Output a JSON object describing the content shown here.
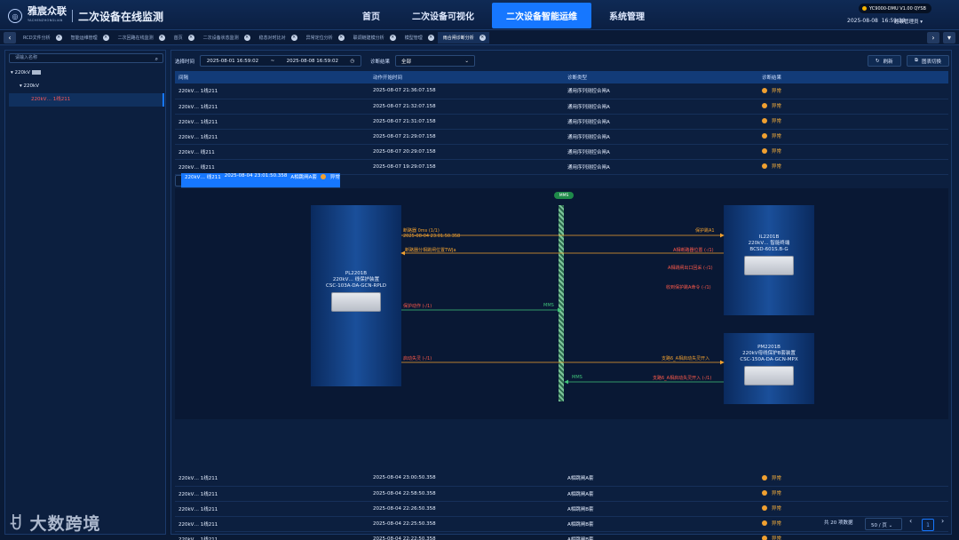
{
  "header": {
    "brand": "雅宸众联",
    "brand_sub": "YACHENZHONGLIAN",
    "system_title": "二次设备在线监测",
    "nav": [
      "首页",
      "二次设备可视化",
      "二次设备智能运维",
      "系统管理"
    ],
    "nav_active": 2,
    "version": "YC9000-DMU V1.00 QYSB",
    "date": "2025-08-08",
    "time": "16:59:38",
    "user": "超级管理员"
  },
  "tabs": [
    "RCD文件分析",
    "智能运维管理",
    "二次回路在线监测",
    "首页",
    "二次设备状态监测",
    "稳态对时比对",
    "异常定位分析",
    "联调链建模分析",
    "模型管理",
    "雨合闸诊断分析"
  ],
  "left": {
    "search_placeholder": "请输入名称",
    "tree_root": "220kV",
    "tree_child": "220kV",
    "tree_leaf": "220kV… 1线211"
  },
  "filter": {
    "time_label": "选择时间",
    "start": "2025-08-01 16:59:02",
    "tilde": "~",
    "end": "2025-08-08 16:59:02",
    "result_label": "诊断结果",
    "result_value": "全部",
    "refresh": "刷新",
    "switch": "图表切换"
  },
  "table": {
    "columns": [
      "间隔",
      "动作开始时间",
      "诊断类型",
      "诊断结果"
    ],
    "rows_top": [
      {
        "bay": "220kV… 1线211",
        "time": "2025-08-07 21:36:07.158",
        "type": "通用序列测控合闸A",
        "result": "异常"
      },
      {
        "bay": "220kV… 1线211",
        "time": "2025-08-07 21:32:07.158",
        "type": "通用序列测控合闸A",
        "result": "异常"
      },
      {
        "bay": "220kV… 1线211",
        "time": "2025-08-07 21:31:07.158",
        "type": "通用序列测控合闸A",
        "result": "异常"
      },
      {
        "bay": "220kV… 1线211",
        "time": "2025-08-07 21:29:07.158",
        "type": "通用序列测控合闸A",
        "result": "异常"
      },
      {
        "bay": "220kV… 线211",
        "time": "2025-08-07 20:29:07.158",
        "type": "通用序列测控合闸A",
        "result": "异常"
      },
      {
        "bay": "220kV… 线211",
        "time": "2025-08-07 19:29:07.158",
        "type": "通用序列测控合闸A",
        "result": "异常"
      },
      {
        "bay": "220kV… 线211",
        "time": "2025-08-04 23:01:50.358",
        "type": "A相跳闸A套",
        "result": "异常"
      }
    ],
    "rows_bottom": [
      {
        "bay": "220kV… 1线211",
        "time": "2025-08-04 23:00:50.358",
        "type": "A相跳闸A套",
        "result": "异常"
      },
      {
        "bay": "220kV… 1线211",
        "time": "2025-08-04 22:58:50.358",
        "type": "A相跳闸A套",
        "result": "异常"
      },
      {
        "bay": "220kV… 1线211",
        "time": "2025-08-04 22:26:50.358",
        "type": "A相跳闸B套",
        "result": "异常"
      },
      {
        "bay": "220kV… 1线211",
        "time": "2025-08-04 22:25:50.358",
        "type": "A相跳闸B套",
        "result": "异常"
      },
      {
        "bay": "220kV… 1线211",
        "time": "2025-08-04 22:22:50.358",
        "type": "A相跳闸B套",
        "result": "异常"
      }
    ]
  },
  "diagram": {
    "bus": "MMS",
    "left_dev": [
      "PL2201B",
      "220kV… 线保护装置",
      "CSC-103A-DA-GCN-RPLD"
    ],
    "right_top_dev": [
      "IL2201B",
      "220kV… 智能终端",
      "BCSD-601S.B-G"
    ],
    "right_bot_dev": [
      "PM2201B",
      "220kV母线保护B套装置",
      "CSC-150A-DA-GCN-MPX"
    ],
    "msgs": [
      "断路器 0ms (1/1)",
      "2025-08-04 23:01:50.358",
      "保护跳A1",
      "断路器分相跳闸位置TWJa",
      "A相断路器位置 (-/1)",
      "A相跳闸出口回采 (-/1)",
      "收到保护跳A命令 (-/1)",
      "保护动作 (-/1)",
      "MMS",
      "启动失灵 (-/1)",
      "支路6_A相启动失灵开入",
      "MMS",
      "支路6_A相启动失灵开入 (-/1)"
    ]
  },
  "footer": {
    "total": "共 20 项数据",
    "page_size": "50 / 页",
    "page": "1"
  },
  "watermark": "大数跨境"
}
